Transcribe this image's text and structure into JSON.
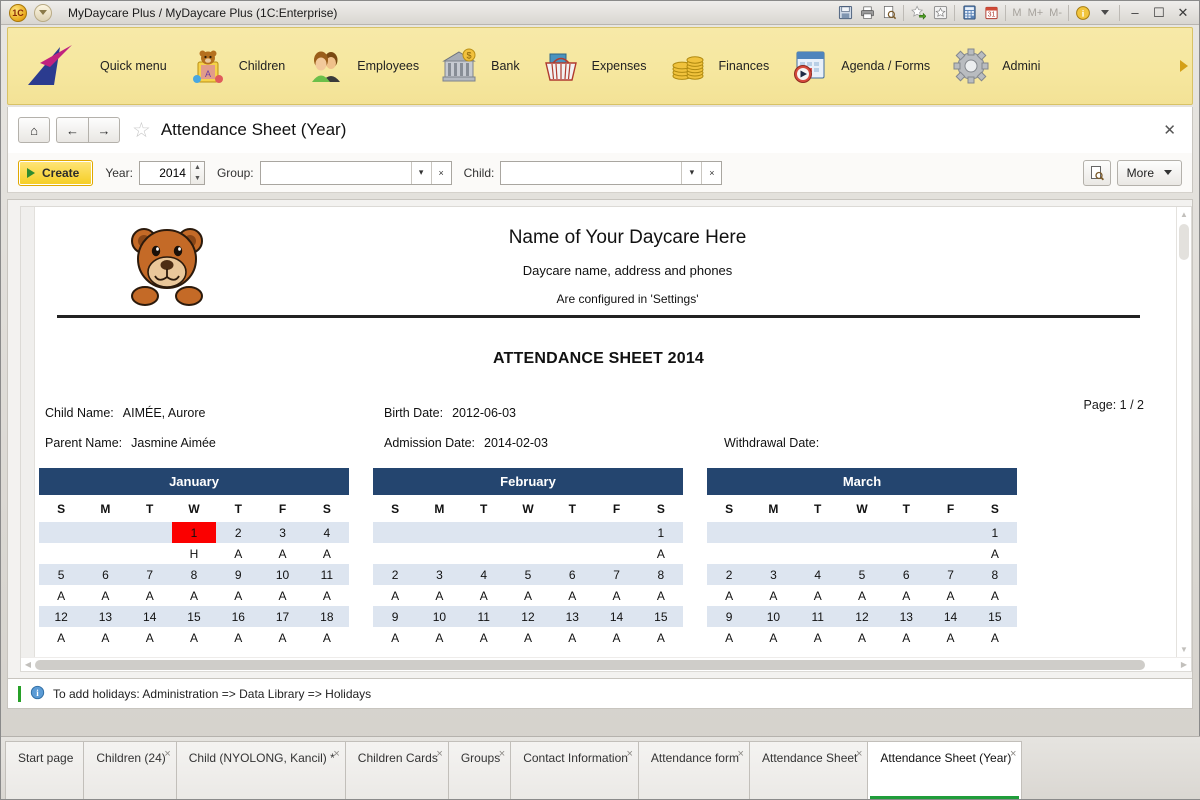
{
  "window": {
    "title": "MyDaycare Plus / MyDaycare Plus  (1C:Enterprise)",
    "logo_text": "1C",
    "toolbar_icons": [
      "save-icon",
      "print-icon",
      "print-preview-icon",
      "add-favorite-icon",
      "favorites-icon",
      "calculator-icon",
      "calendar-icon"
    ],
    "memory": {
      "m": "M",
      "mplus": "M+",
      "mminus": "M-"
    },
    "minimize": "–",
    "maximize": "☐",
    "close": "✕"
  },
  "nav": {
    "items": [
      {
        "label": "Quick menu",
        "icon": "quick-menu-icon"
      },
      {
        "label": "Children",
        "icon": "children-toyblock-icon"
      },
      {
        "label": "Employees",
        "icon": "employees-people-icon"
      },
      {
        "label": "Bank",
        "icon": "bank-building-icon"
      },
      {
        "label": "Expenses",
        "icon": "expenses-basket-icon"
      },
      {
        "label": "Finances",
        "icon": "finances-coins-icon"
      },
      {
        "label": "Agenda / Forms",
        "icon": "agenda-calendar-icon"
      },
      {
        "label": "Admini",
        "icon": "administration-gear-icon"
      }
    ]
  },
  "form_header": {
    "home": "⌂",
    "back": "←",
    "forward": "→",
    "favorite": "☆",
    "title": "Attendance Sheet (Year)",
    "close": "✕"
  },
  "commandbar": {
    "create_label": "Create",
    "year_label": "Year:",
    "year_value": "2014",
    "group_label": "Group:",
    "group_value": "",
    "child_label": "Child:",
    "child_value": "",
    "dropdown_caret": "▾",
    "clear_mark": "×",
    "find_icon": "find-icon",
    "more_label": "More"
  },
  "document": {
    "daycare_name": "Name of Your Daycare Here",
    "daycare_sub1": "Daycare name, address and phones",
    "daycare_sub2": "Are configured in 'Settings'",
    "sheet_title": "ATTENDANCE SHEET 2014",
    "fields": {
      "child_name_label": "Child Name:",
      "child_name_value": "AIMÉE, Aurore",
      "parent_name_label": "Parent Name:",
      "parent_name_value": "Jasmine Aimée",
      "birth_date_label": "Birth Date:",
      "birth_date_value": "2012-06-03",
      "admission_date_label": "Admission Date:",
      "admission_date_value": "2014-02-03",
      "withdrawal_date_label": "Withdrawal Date:",
      "withdrawal_date_value": "",
      "page_label": "Page: 1 / 2"
    },
    "weekday_headers": [
      "S",
      "M",
      "T",
      "W",
      "T",
      "F",
      "S"
    ],
    "calendars": [
      {
        "month": "January",
        "weeks": [
          {
            "days": [
              "",
              "",
              "",
              "1",
              "2",
              "3",
              "4"
            ],
            "holidays": [
              false,
              false,
              false,
              true,
              false,
              false,
              false
            ],
            "attendance": [
              "",
              "",
              "",
              "H",
              "A",
              "A",
              "A"
            ],
            "attendance_holiday": [
              false,
              false,
              false,
              true,
              false,
              false,
              false
            ]
          },
          {
            "days": [
              "5",
              "6",
              "7",
              "8",
              "9",
              "10",
              "11"
            ],
            "holidays": [
              false,
              false,
              false,
              false,
              false,
              false,
              false
            ],
            "attendance": [
              "A",
              "A",
              "A",
              "A",
              "A",
              "A",
              "A"
            ],
            "attendance_holiday": [
              false,
              false,
              false,
              false,
              false,
              false,
              false
            ]
          },
          {
            "days": [
              "12",
              "13",
              "14",
              "15",
              "16",
              "17",
              "18"
            ],
            "holidays": [
              false,
              false,
              false,
              false,
              false,
              false,
              false
            ],
            "attendance": [
              "A",
              "A",
              "A",
              "A",
              "A",
              "A",
              "A"
            ],
            "attendance_holiday": [
              false,
              false,
              false,
              false,
              false,
              false,
              false
            ]
          }
        ]
      },
      {
        "month": "February",
        "weeks": [
          {
            "days": [
              "",
              "",
              "",
              "",
              "",
              "",
              "1"
            ],
            "holidays": [
              false,
              false,
              false,
              false,
              false,
              false,
              false
            ],
            "attendance": [
              "",
              "",
              "",
              "",
              "",
              "",
              "A"
            ],
            "attendance_holiday": [
              false,
              false,
              false,
              false,
              false,
              false,
              false
            ]
          },
          {
            "days": [
              "2",
              "3",
              "4",
              "5",
              "6",
              "7",
              "8"
            ],
            "holidays": [
              false,
              false,
              false,
              false,
              false,
              false,
              false
            ],
            "attendance": [
              "A",
              "A",
              "A",
              "A",
              "A",
              "A",
              "A"
            ],
            "attendance_holiday": [
              false,
              false,
              false,
              false,
              false,
              false,
              false
            ]
          },
          {
            "days": [
              "9",
              "10",
              "11",
              "12",
              "13",
              "14",
              "15"
            ],
            "holidays": [
              false,
              false,
              false,
              false,
              false,
              false,
              false
            ],
            "attendance": [
              "A",
              "A",
              "A",
              "A",
              "A",
              "A",
              "A"
            ],
            "attendance_holiday": [
              false,
              false,
              false,
              false,
              false,
              false,
              false
            ]
          }
        ]
      },
      {
        "month": "March",
        "weeks": [
          {
            "days": [
              "",
              "",
              "",
              "",
              "",
              "",
              "1"
            ],
            "holidays": [
              false,
              false,
              false,
              false,
              false,
              false,
              false
            ],
            "attendance": [
              "",
              "",
              "",
              "",
              "",
              "",
              "A"
            ],
            "attendance_holiday": [
              false,
              false,
              false,
              false,
              false,
              false,
              false
            ]
          },
          {
            "days": [
              "2",
              "3",
              "4",
              "5",
              "6",
              "7",
              "8"
            ],
            "holidays": [
              false,
              false,
              false,
              false,
              false,
              false,
              false
            ],
            "attendance": [
              "A",
              "A",
              "A",
              "A",
              "A",
              "A",
              "A"
            ],
            "attendance_holiday": [
              false,
              false,
              false,
              false,
              false,
              false,
              false
            ]
          },
          {
            "days": [
              "9",
              "10",
              "11",
              "12",
              "13",
              "14",
              "15"
            ],
            "holidays": [
              false,
              false,
              false,
              false,
              false,
              false,
              false
            ],
            "attendance": [
              "A",
              "A",
              "A",
              "A",
              "A",
              "A",
              "A"
            ],
            "attendance_holiday": [
              false,
              false,
              false,
              false,
              false,
              false,
              false
            ]
          }
        ]
      }
    ]
  },
  "infobar": {
    "text": "To add holidays: Administration => Data Library => Holidays"
  },
  "tabs": [
    {
      "label": "Start page",
      "closable": false,
      "active": false
    },
    {
      "label": "Children (24)",
      "closable": true,
      "active": false
    },
    {
      "label": "Child (NYOLONG, Kancil) *",
      "closable": true,
      "active": false
    },
    {
      "label": "Children Cards",
      "closable": true,
      "active": false
    },
    {
      "label": "Groups",
      "closable": true,
      "active": false
    },
    {
      "label": "Contact Information",
      "closable": true,
      "active": false
    },
    {
      "label": "Attendance form",
      "closable": true,
      "active": false
    },
    {
      "label": "Attendance Sheet",
      "closable": true,
      "active": false
    },
    {
      "label": "Attendance Sheet (Year)",
      "closable": true,
      "active": true
    }
  ],
  "colors": {
    "nav_bg": "#f6e79f",
    "calendar_header": "#24456f",
    "day_row": "#dde5f0",
    "holiday": "#fb0000",
    "active_tab_underline": "#1f9d3a"
  }
}
